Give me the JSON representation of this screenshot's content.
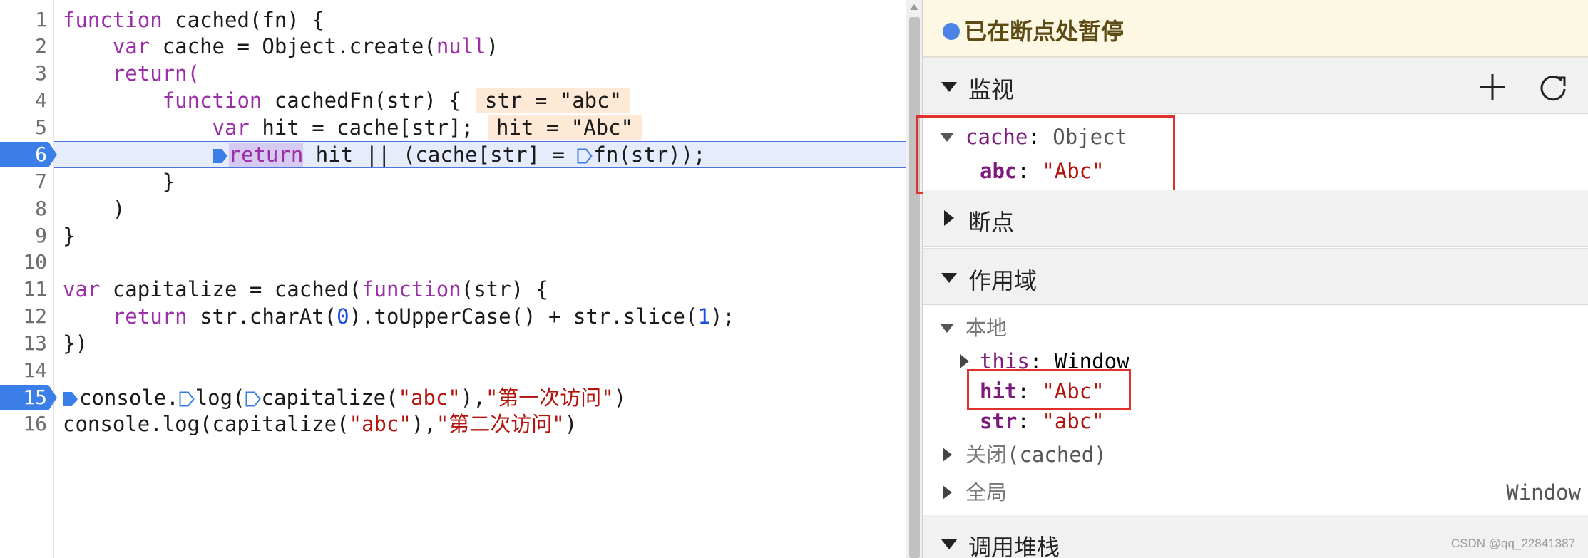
{
  "editor": {
    "line_numbers": [
      "1",
      "2",
      "3",
      "4",
      "5",
      "6",
      "7",
      "8",
      "9",
      "10",
      "11",
      "12",
      "13",
      "14",
      "15",
      "16"
    ],
    "current_line": "6",
    "breakpoint_lines": [
      "6",
      "15"
    ],
    "code": {
      "l1_kw": "function",
      "l1_rest": " cached(fn) {",
      "l2_indent": "    ",
      "l2_kw": "var",
      "l2_mid": " cache = Object.create(",
      "l2_null": "null",
      "l2_end": ")",
      "l3_indent": "    ",
      "l3_kw": "return(",
      "l4_indent": "        ",
      "l4_kw": "function",
      "l4_rest": " cachedFn(str) {",
      "l5_indent": "            ",
      "l5_kw": "var",
      "l5_rest": " hit = cache[str];",
      "l6_indent": "            ",
      "l6_kw": "return",
      "l6_mid": " hit || (cache[str] = ",
      "l6_end": "fn(str));",
      "l7": "        }",
      "l8": "    )",
      "l9": "}",
      "l11_kw": "var",
      "l11_mid": " capitalize = cached(",
      "l11_fn": "function",
      "l11_end": "(str) {",
      "l12_indent": "    ",
      "l12_kw": "return",
      "l12_mid": " str.charAt(",
      "l12_n0": "0",
      "l12_mid2": ").toUpperCase() + str.slice(",
      "l12_n1": "1",
      "l12_end": ");",
      "l13": "})",
      "l15_a": "console.",
      "l15_b": "log(",
      "l15_c": "capitalize(",
      "l15_s1": "\"abc\"",
      "l15_d": "),",
      "l15_s2": "\"第一次访问\"",
      "l15_e": ")",
      "l16_a": "console.log(capitalize(",
      "l16_s1": "\"abc\"",
      "l16_d": "),",
      "l16_s2": "\"第二次访问\"",
      "l16_e": ")"
    },
    "inline_values": {
      "l4": "str = \"abc\"",
      "l5": "hit = \"Abc\""
    }
  },
  "panel": {
    "paused_text": "已在断点处暂停",
    "sections": {
      "watch": "监视",
      "breakpoints": "断点",
      "scopes": "作用域",
      "callstack": "调用堆栈"
    },
    "watch": {
      "cache_key": "cache",
      "cache_colon": ": ",
      "cache_type": "Object",
      "abc_key": "abc",
      "abc_colon": ": ",
      "abc_value": "\"Abc\""
    },
    "scope": {
      "local_label": "本地",
      "this_key": "this",
      "this_colon": ": ",
      "this_value": "Window",
      "hit_key": "hit",
      "hit_colon": ": ",
      "hit_value": "\"Abc\"",
      "str_key": "str",
      "str_colon": ": ",
      "str_value": "\"abc\"",
      "closure_label": "关闭",
      "closure_name": "(cached)",
      "global_label": "全局",
      "global_value": "Window"
    },
    "icons": {
      "add": "plus-icon",
      "refresh": "refresh-icon"
    }
  },
  "watermark": "CSDN @qq_22841387"
}
